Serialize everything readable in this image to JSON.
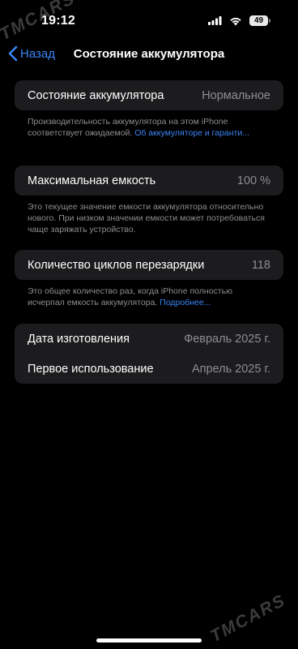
{
  "status_bar": {
    "time": "19:12",
    "battery_level": "49"
  },
  "nav": {
    "back_label": "Назад",
    "title": "Состояние аккумулятора"
  },
  "battery_health": {
    "label": "Состояние аккумулятора",
    "value": "Нормальное",
    "footer_text": "Производительность аккумулятора на этом iPhone соответствует ожидаемой. ",
    "footer_link": "Об аккумуляторе и гаранти..."
  },
  "max_capacity": {
    "label": "Максимальная емкость",
    "value": "100 %",
    "footer_text": "Это текущее значение емкости аккумулятора относительно нового. При низком значении емкости может потребоваться чаще заряжать устройство."
  },
  "cycle_count": {
    "label": "Количество циклов перезарядки",
    "value": "118",
    "footer_text": "Это общее количество раз, когда iPhone полностью исчерпал емкость аккумулятора. ",
    "footer_link": "Подробнее..."
  },
  "dates": {
    "manufacture_label": "Дата изготовления",
    "manufacture_value": "Февраль 2025 г.",
    "first_use_label": "Первое использование",
    "first_use_value": "Апрель 2025 г."
  },
  "watermark": {
    "text": "TMCARS"
  }
}
